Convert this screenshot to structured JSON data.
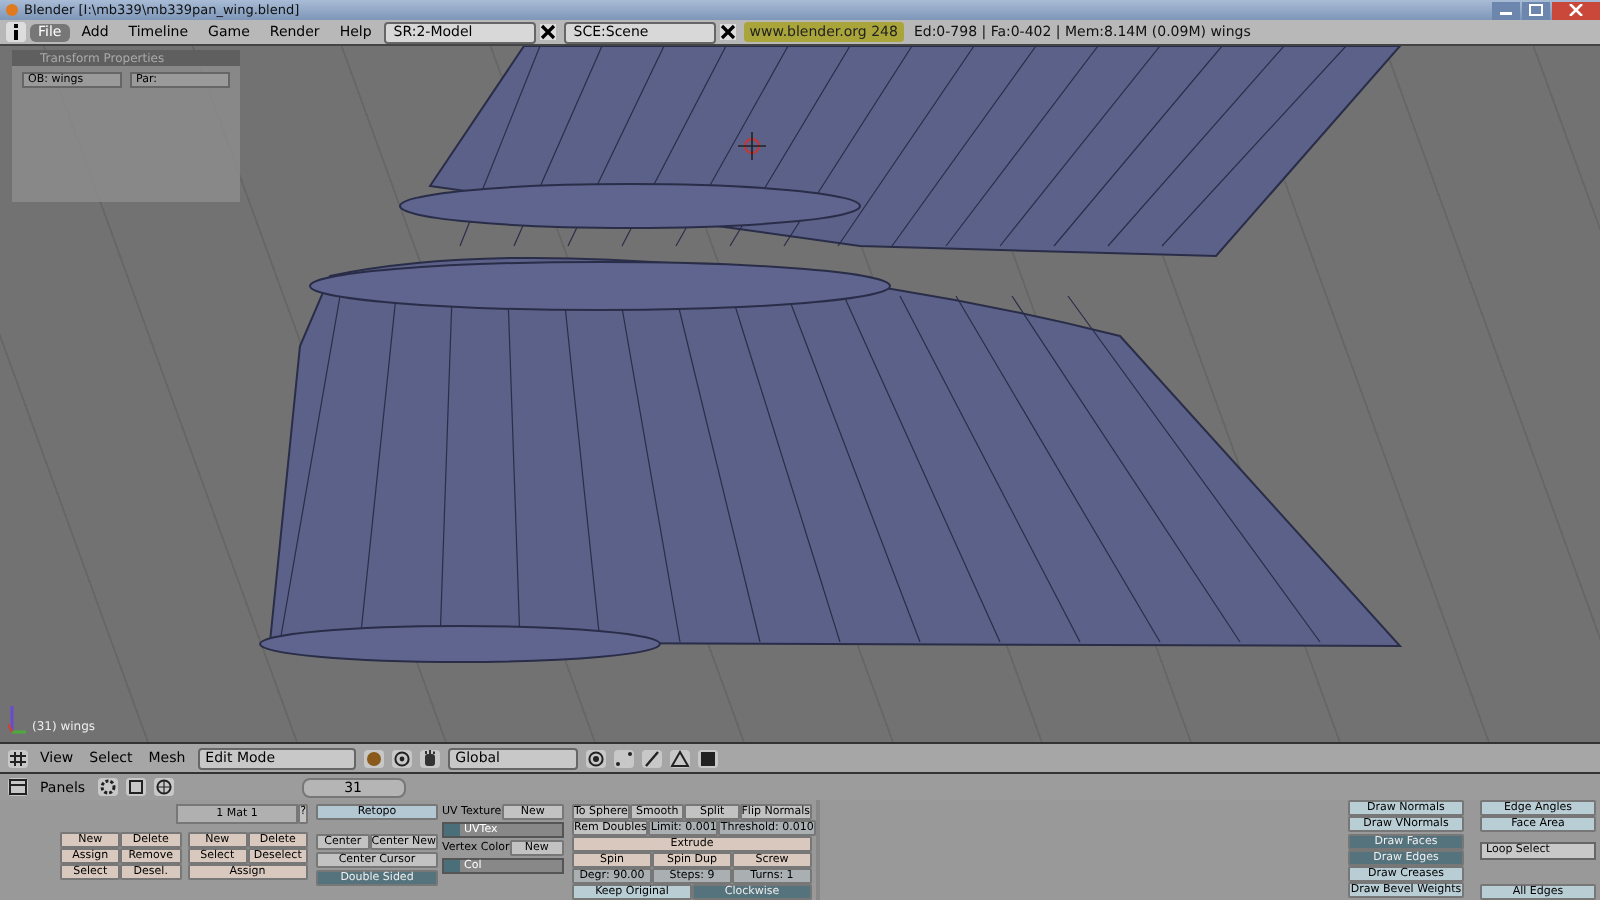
{
  "title_bar": {
    "title": "Blender [I:\\mb339\\mb339pan_wing.blend]"
  },
  "menu_bar": {
    "menus": [
      {
        "label": "File",
        "selected": true
      },
      {
        "label": "Add",
        "selected": false
      },
      {
        "label": "Timeline",
        "selected": false
      },
      {
        "label": "Game",
        "selected": false
      },
      {
        "label": "Render",
        "selected": false
      },
      {
        "label": "Help",
        "selected": false
      }
    ],
    "screen_field": "SR:2-Model",
    "scene_field": "SCE:Scene",
    "website": "www.blender.org 248",
    "stats": "Ed:0-798 | Fa:0-402 | Mem:8.14M (0.09M) wings"
  },
  "viewport": {
    "transform_panel": {
      "title": "Transform Properties",
      "object_field": "OB: wings",
      "parent_field": "Par:"
    },
    "object_label": "(31) wings"
  },
  "view_header": {
    "menus": [
      "View",
      "Select",
      "Mesh"
    ],
    "mode": "Edit Mode",
    "orientation": "Global"
  },
  "buttons_header": {
    "label": "Panels",
    "frame": "31"
  },
  "material_panel": {
    "selector": "1 Mat 1",
    "help": "?",
    "group_buttons": [
      "New",
      "Delete",
      "Assign",
      "Remove",
      "Select",
      "Desel."
    ],
    "material_buttons": [
      "New",
      "Delete",
      "Select",
      "Deselect",
      "Assign"
    ]
  },
  "mesh_panel": {
    "retopo": "Retopo",
    "center_buttons": [
      "Center",
      "Center New"
    ],
    "center_cursor": "Center Cursor",
    "double_sided": {
      "label": "Double Sided",
      "on": true
    },
    "uv_texture_label": "UV Texture",
    "uv_new": "New",
    "uv_field": "UVTex",
    "vertex_color_label": "Vertex Color",
    "vc_new": "New",
    "vc_field": "Col"
  },
  "tools_panel": {
    "row1": [
      "To Sphere",
      "Smooth",
      "Split",
      "Flip Normals"
    ],
    "rem_doubles": "Rem Doubles",
    "limit": "Limit: 0.001",
    "threshold": "Threshold: 0.010",
    "extrude": "Extrude",
    "spin_row": [
      "Spin",
      "Spin Dup",
      "Screw"
    ],
    "degr": "Degr: 90.00",
    "steps": "Steps: 9",
    "turns": "Turns: 1",
    "toggles": [
      {
        "label": "Keep Original",
        "on": false
      },
      {
        "label": "Clockwise",
        "on": true
      }
    ]
  },
  "draw_panel": {
    "toggles": [
      {
        "label": "Draw Normals",
        "on": false
      },
      {
        "label": "Draw VNormals",
        "on": false
      },
      {
        "label": "Draw Faces",
        "on": true
      },
      {
        "label": "Draw Edges",
        "on": true
      },
      {
        "label": "Draw Creases",
        "on": false
      },
      {
        "label": "Draw Bevel Weights",
        "on": false
      }
    ],
    "measure": [
      {
        "label": "Edge Angles",
        "on": false
      },
      {
        "label": "Face Area",
        "on": false
      }
    ],
    "loop_select": "Loop Select",
    "all_edges": "All Edges"
  }
}
